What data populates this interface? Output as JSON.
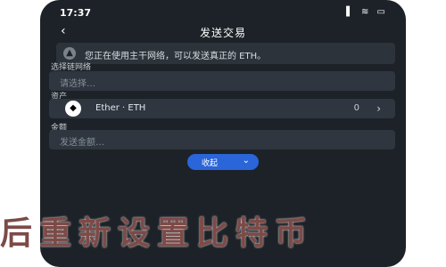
{
  "status_bar": {
    "time": "17:37",
    "icons": "▌ ≋ ▭"
  },
  "header": {
    "title": "发送交易",
    "back_icon": "‹"
  },
  "notice": {
    "text": "您正在使用主干网络，可以发送真正的 ETH。",
    "icon": "▲"
  },
  "form": {
    "network_label": "选择链网络",
    "network_placeholder": "请选择…",
    "asset_label": "资产",
    "asset": {
      "icon": "◆",
      "name": "Ether · ETH",
      "balance": "0",
      "chevron": "›"
    },
    "recipient_label": "金额",
    "recipient_placeholder": "发送金额…",
    "collapse_label": "收起",
    "collapse_icon": "⌄"
  },
  "overlay_text": "后重新设置比特币"
}
